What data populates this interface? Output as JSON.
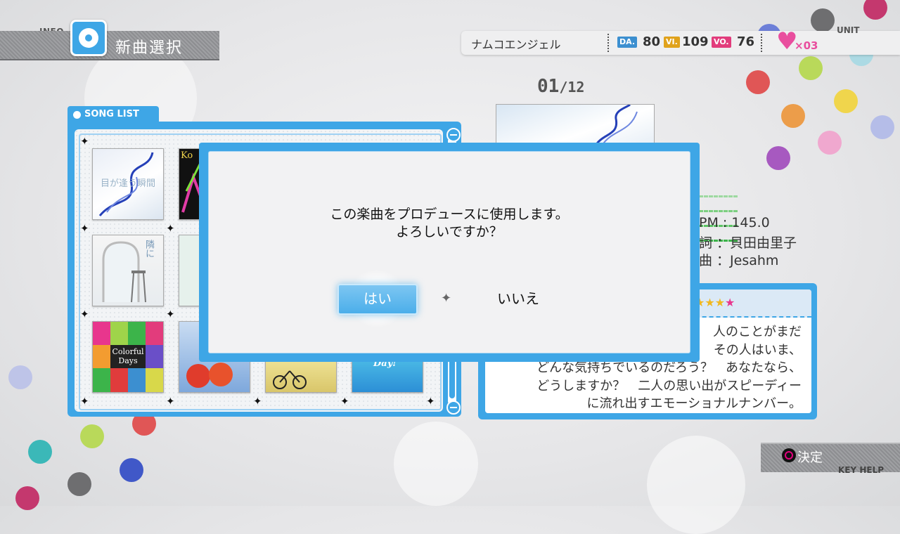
{
  "header": {
    "info_tag": "INFO",
    "title": "新曲選択",
    "unit_tag": "UNIT",
    "unit_name": "ナムコエンジェル",
    "stats": [
      {
        "badge": "DA.",
        "value": "80",
        "color": "#3c8fd0"
      },
      {
        "badge": "VI.",
        "value": "109",
        "color": "#e0a21c"
      },
      {
        "badge": "VO.",
        "value": "76",
        "color": "#e23c7c"
      }
    ],
    "heart_count": "×03"
  },
  "song_list": {
    "label": "SONG LIST",
    "jackets": [
      {
        "title": "目が逢う瞬間",
        "style": "blue-swirl"
      },
      {
        "title": "Ko",
        "style": "neon"
      },
      {
        "title": "隣に",
        "style": "window-chair"
      },
      {
        "title": "",
        "style": "green-silhouette"
      },
      {
        "title": "Colorful Days",
        "style": "silhouettes"
      },
      {
        "title": "",
        "style": "apples"
      },
      {
        "title": "",
        "style": "bicycle"
      },
      {
        "title": "Day!",
        "style": "blue-pop"
      }
    ]
  },
  "detail": {
    "counter_current": "01",
    "counter_total": "/12",
    "bpm": "PM : 145.0",
    "lyrics": "詞 ：貝田由里子",
    "composer": "曲 ：Jesahm",
    "stars": "★★★",
    "description": "人のことがまだ\nその人はいま、\nどんな気持ちでいるのだろう？　あなたなら、\nどうしますか？　二人の思い出がスピーディー\nに流れ出すエモーショナルナンバー。"
  },
  "dialog": {
    "message": "この楽曲をプロデュースに使用します。\nよろしいですか？",
    "yes_label": "はい",
    "no_label": "いいえ"
  },
  "key_help": {
    "action": "決定",
    "label": "KEY HELP"
  }
}
